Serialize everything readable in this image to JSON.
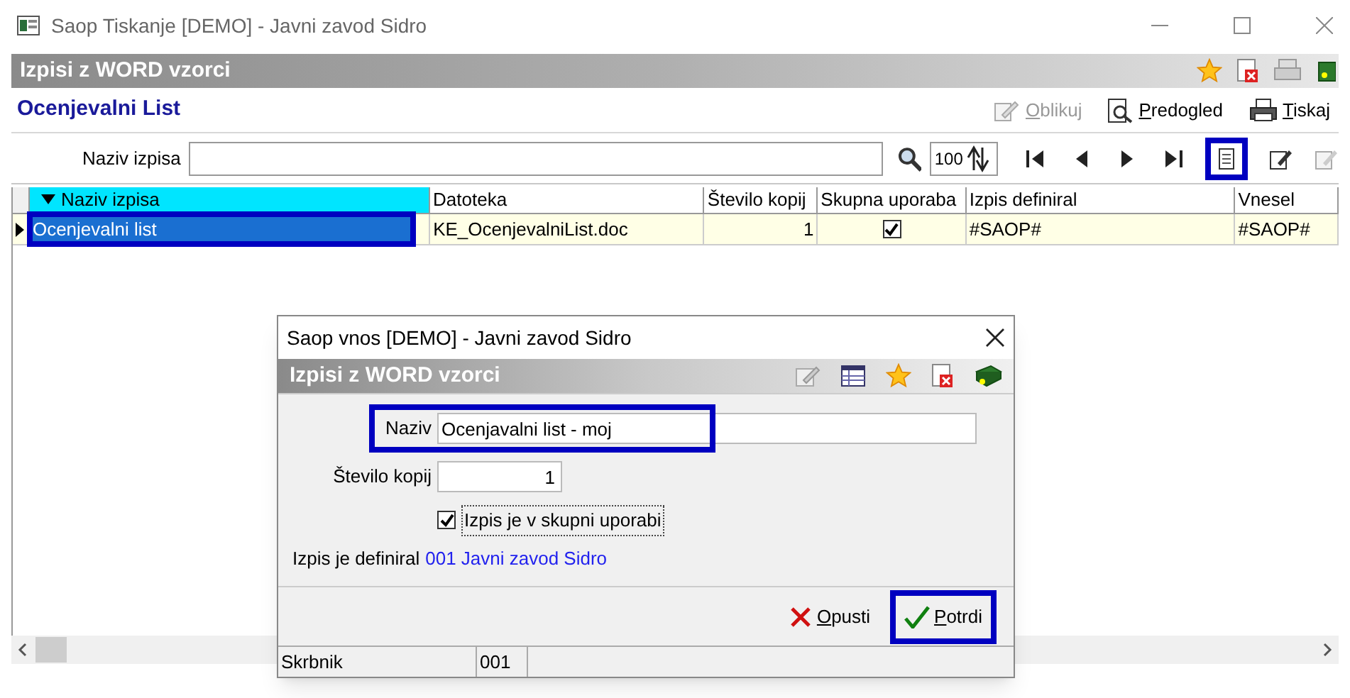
{
  "window": {
    "title": "Saop Tiskanje [DEMO] - Javni zavod Sidro"
  },
  "header": {
    "title": "Izpisi z WORD vzorci"
  },
  "form": {
    "title": "Ocenjevalni List",
    "actions": [
      {
        "label": "Oblikuj",
        "kind": "edit",
        "disabled": true
      },
      {
        "label": "Predogled",
        "kind": "preview",
        "disabled": false
      },
      {
        "label": "Tiskaj",
        "kind": "print",
        "disabled": false
      }
    ]
  },
  "filter": {
    "label": "Naziv izpisa",
    "zoom": "100"
  },
  "toolbar": [
    {
      "kind": "first",
      "highlighted": false
    },
    {
      "kind": "prev",
      "highlighted": false
    },
    {
      "kind": "next",
      "highlighted": false
    },
    {
      "kind": "last",
      "highlighted": false
    },
    {
      "kind": "copy",
      "highlighted": true
    },
    {
      "kind": "edit",
      "highlighted": false
    },
    {
      "kind": "edit-disabled",
      "highlighted": false
    }
  ],
  "table": {
    "columns": [
      {
        "label": "Naziv izpisa",
        "sorted": true
      },
      {
        "label": "Datoteka",
        "sorted": false
      },
      {
        "label": "Število kopij",
        "sorted": false
      },
      {
        "label": "Skupna uporaba",
        "sorted": false
      },
      {
        "label": "Izpis definiral",
        "sorted": false
      },
      {
        "label": "Vnesel",
        "sorted": false
      }
    ],
    "rows": [
      {
        "name": "Ocenjevalni list",
        "file": "KE_OcenjevalniList.doc",
        "copies": "1",
        "shared": true,
        "defined_by": "#SAOP#",
        "entered_by": "#SAOP#",
        "selected": true,
        "highlighted": true
      }
    ]
  },
  "dialog": {
    "title": "Saop vnos [DEMO] - Javni zavod Sidro",
    "header": "Izpisi z WORD vzorci",
    "name_field": {
      "label": "Naziv",
      "value": "Ocenjavalni list - moj",
      "highlighted": true
    },
    "copies_field": {
      "label": "Število kopij",
      "value": "1"
    },
    "shared": {
      "label": "Izpis je v skupni uporabi",
      "checked": true
    },
    "defined": {
      "label": "Izpis je definiral",
      "value": "001 Javni zavod Sidro"
    },
    "buttons": [
      {
        "label": "Opusti",
        "kind": "cancel",
        "highlighted": false
      },
      {
        "label": "Potrdi",
        "kind": "confirm",
        "highlighted": true
      }
    ],
    "status_bar": [
      "Skrbnik",
      "001"
    ]
  }
}
